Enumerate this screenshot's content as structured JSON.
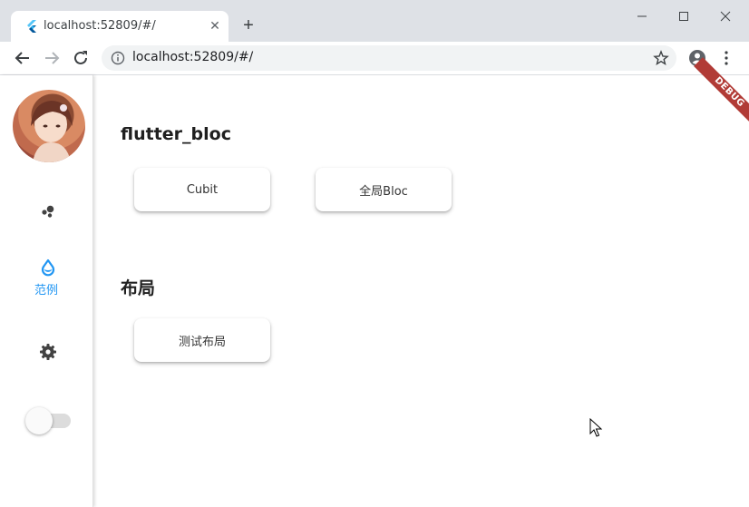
{
  "browser": {
    "tab_title": "localhost:52809/#/",
    "tab_close": "✕",
    "new_tab": "+",
    "url": "localhost:52809/#/"
  },
  "rail": {
    "items": [
      {
        "label": "",
        "icon": "bubbles-icon"
      },
      {
        "label": "范例",
        "icon": "water-drop-icon"
      },
      {
        "label": "",
        "icon": "settings-icon"
      }
    ],
    "toggle_on": false
  },
  "content": {
    "sections": [
      {
        "title": "flutter_bloc",
        "buttons": [
          "Cubit",
          "全局Bloc"
        ]
      },
      {
        "title": "布局",
        "buttons": [
          "测试布局"
        ]
      }
    ],
    "debug_banner": "DEBUG"
  },
  "colors": {
    "accent": "#2196f3",
    "debug": "#b13b36"
  }
}
